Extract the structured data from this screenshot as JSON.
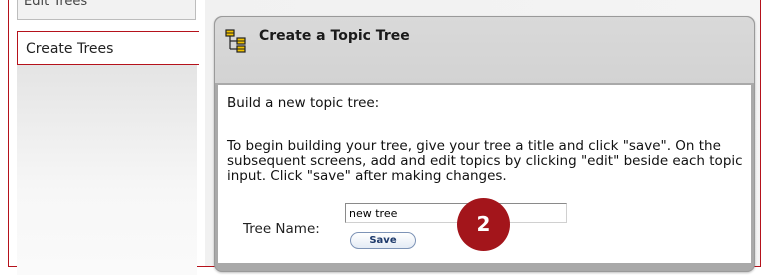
{
  "sidebar": {
    "items": [
      {
        "label": "Edit Trees"
      },
      {
        "label": "Create Trees"
      }
    ]
  },
  "panel": {
    "title": "Create a Topic Tree",
    "intro": "Build a new topic tree:",
    "instructions": "To begin building your tree, give your tree a title and click \"save\". On the subsequent screens, add and edit topics by clicking \"edit\" beside each topic input. Click \"save\" after making changes.",
    "tree_name_label": "Tree Name:",
    "tree_name_value": "new tree",
    "save_label": "Save"
  },
  "callout": {
    "number": "2"
  },
  "colors": {
    "accent_red": "#b5121b",
    "callout": "#a3151b",
    "header_gray": "#d6d6d6",
    "panel_border": "#a9a9a9",
    "button_text": "#1e3a6b",
    "icon_yellow": "#f2c200"
  },
  "icons": {
    "header_icon": "tree-structure-icon"
  }
}
